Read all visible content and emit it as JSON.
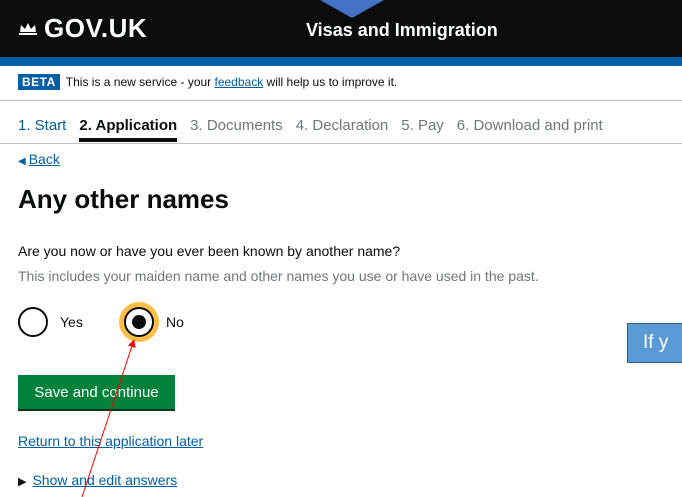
{
  "header": {
    "logo_text": "GOV.UK",
    "service_name": "Visas and Immigration"
  },
  "beta": {
    "tag": "BETA",
    "text_before": "This is a new service - your ",
    "link": "feedback",
    "text_after": " will help us to improve it."
  },
  "steps": [
    {
      "label": "1. Start"
    },
    {
      "label": "2. Application"
    },
    {
      "label": "3. Documents"
    },
    {
      "label": "4. Declaration"
    },
    {
      "label": "5. Pay"
    },
    {
      "label": "6. Download and print"
    }
  ],
  "back_link": "Back",
  "page_title": "Any other names",
  "question": "Are you now or have you ever been known by another name?",
  "hint": "This includes your maiden name and other names you use or have used in the past.",
  "options": {
    "yes": "Yes",
    "no": "No",
    "selected": "No"
  },
  "buttons": {
    "save": "Save and continue"
  },
  "links": {
    "return_later": "Return to this application later",
    "show_edit": "Show and edit answers"
  },
  "annotation": {
    "callout_text": "If y"
  },
  "colors": {
    "header_bg": "#0b0c0c",
    "brand_blue": "#005ea5",
    "button_green": "#00823b",
    "focus_yellow": "#ffbf47",
    "callout_blue": "#5b9bd5",
    "arrow_red": "#ff0000"
  }
}
